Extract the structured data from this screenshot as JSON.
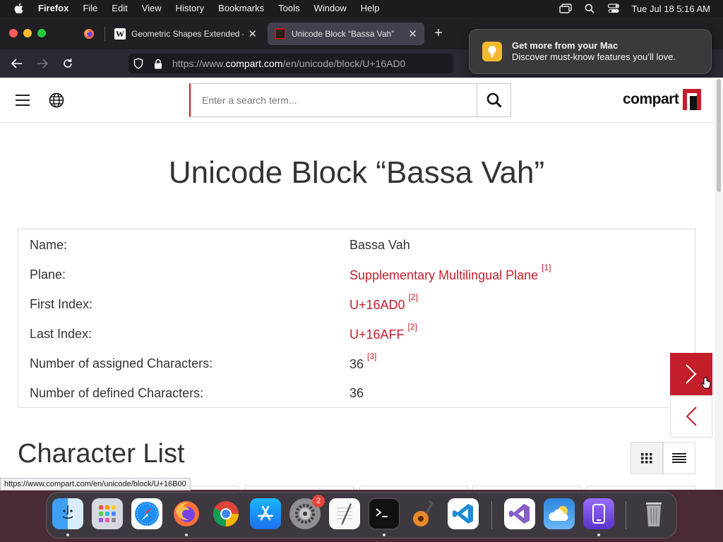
{
  "menubar": {
    "app_name": "Firefox",
    "items": [
      "File",
      "Edit",
      "View",
      "History",
      "Bookmarks",
      "Tools",
      "Window",
      "Help"
    ],
    "clock": "Tue Jul 18  5:16 AM"
  },
  "browser": {
    "tabs": [
      {
        "label": "Geometric Shapes Extended - W",
        "favicon": "W"
      },
      {
        "label": "Unicode Block “Bassa Vah”"
      }
    ],
    "url_prefix": "https://www.",
    "url_host": "compart.com",
    "url_path": "/en/unicode/block/U+16AD0",
    "status_url": "https://www.compart.com/en/unicode/block/U+16B00"
  },
  "notification": {
    "title": "Get more from your Mac",
    "body": "Discover must-know features you’ll love."
  },
  "site": {
    "search_placeholder": "Enter a search term...",
    "logo_text": "compart",
    "page_title": "Unicode Block “Bassa Vah”",
    "info_rows": [
      {
        "key": "Name:",
        "value": "Bassa Vah",
        "ref": ""
      },
      {
        "key": "Plane:",
        "value": "Supplementary Multilingual Plane",
        "ref": "[1]"
      },
      {
        "key": "First Index:",
        "value": "U+16AD0",
        "ref": "[2]"
      },
      {
        "key": "Last Index:",
        "value": "U+16AFF",
        "ref": "[2]"
      },
      {
        "key": "Number of assigned Characters:",
        "value": "36",
        "ref": "[3]"
      },
      {
        "key": "Number of defined Characters:",
        "value": "36",
        "ref": ""
      }
    ],
    "section_heading": "Character List"
  },
  "dock": {
    "apps": [
      "finder",
      "launchpad",
      "safari",
      "firefox",
      "chrome",
      "app-store",
      "system-settings",
      "textedit",
      "terminal",
      "garageband",
      "vscode",
      "visual-studio",
      "weather",
      "simulator",
      "trash"
    ],
    "system_settings_badge": "2"
  },
  "colors": {
    "brand_red": "#c41e2b",
    "link": "#c41e2b"
  }
}
